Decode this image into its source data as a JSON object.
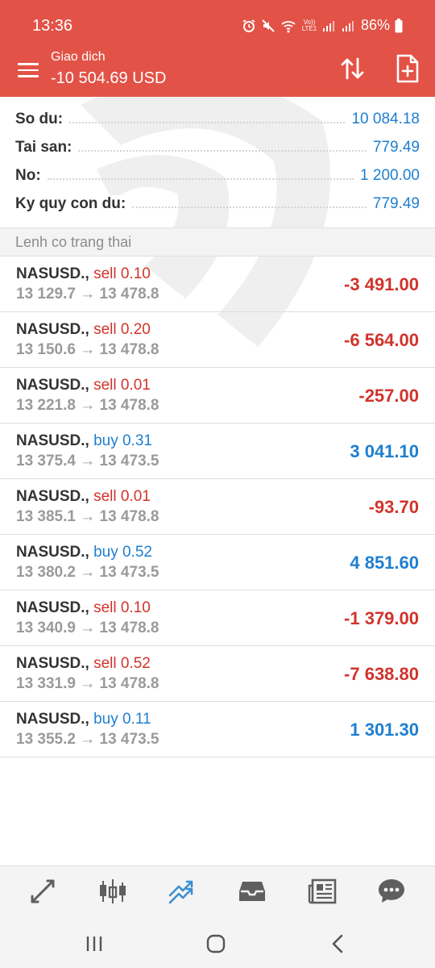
{
  "status_bar": {
    "time": "13:36",
    "network_label": "Vo)) LTE1",
    "battery": "86%"
  },
  "appbar": {
    "title": "Giao dich",
    "balance": "-10 504.69 USD"
  },
  "summary": [
    {
      "label": "So du:",
      "value": "10 084.18"
    },
    {
      "label": "Tai san:",
      "value": "779.49"
    },
    {
      "label": "No:",
      "value": "1 200.00"
    },
    {
      "label": "Ky quy con du:",
      "value": "779.49"
    }
  ],
  "section_title": "Lenh co trang thai",
  "orders": [
    {
      "symbol": "NASUSD.,",
      "type": "sell 0.10",
      "side": "sell",
      "prices": "13 129.7 → 13 478.8",
      "profit": "-3 491.00"
    },
    {
      "symbol": "NASUSD.,",
      "type": "sell 0.20",
      "side": "sell",
      "prices": "13 150.6 → 13 478.8",
      "profit": "-6 564.00"
    },
    {
      "symbol": "NASUSD.,",
      "type": "sell 0.01",
      "side": "sell",
      "prices": "13 221.8 → 13 478.8",
      "profit": "-257.00"
    },
    {
      "symbol": "NASUSD.,",
      "type": "buy 0.31",
      "side": "buy",
      "prices": "13 375.4 → 13 473.5",
      "profit": "3 041.10"
    },
    {
      "symbol": "NASUSD.,",
      "type": "sell 0.01",
      "side": "sell",
      "prices": "13 385.1 → 13 478.8",
      "profit": "-93.70"
    },
    {
      "symbol": "NASUSD.,",
      "type": "buy 0.52",
      "side": "buy",
      "prices": "13 380.2 → 13 473.5",
      "profit": "4 851.60"
    },
    {
      "symbol": "NASUSD.,",
      "type": "sell 0.10",
      "side": "sell",
      "prices": "13 340.9 → 13 478.8",
      "profit": "-1 379.00"
    },
    {
      "symbol": "NASUSD.,",
      "type": "sell 0.52",
      "side": "sell",
      "prices": "13 331.9 → 13 478.8",
      "profit": "-7 638.80"
    },
    {
      "symbol": "NASUSD.,",
      "type": "buy 0.11",
      "side": "buy",
      "prices": "13 355.2 → 13 473.5",
      "profit": "1 301.30"
    }
  ],
  "bottom_nav": [
    {
      "icon": "quotes-arrows-icon",
      "active": false
    },
    {
      "icon": "candlestick-chart-icon",
      "active": false
    },
    {
      "icon": "trade-trend-icon",
      "active": true
    },
    {
      "icon": "inbox-tray-icon",
      "active": false
    },
    {
      "icon": "news-icon",
      "active": false
    },
    {
      "icon": "chat-bubble-icon",
      "active": false
    }
  ],
  "colors": {
    "header": "#e25247",
    "sell": "#d0342c",
    "buy": "#1e7fd0",
    "nav_icon": "#5f5f5f",
    "nav_active": "#3a8fd6"
  }
}
